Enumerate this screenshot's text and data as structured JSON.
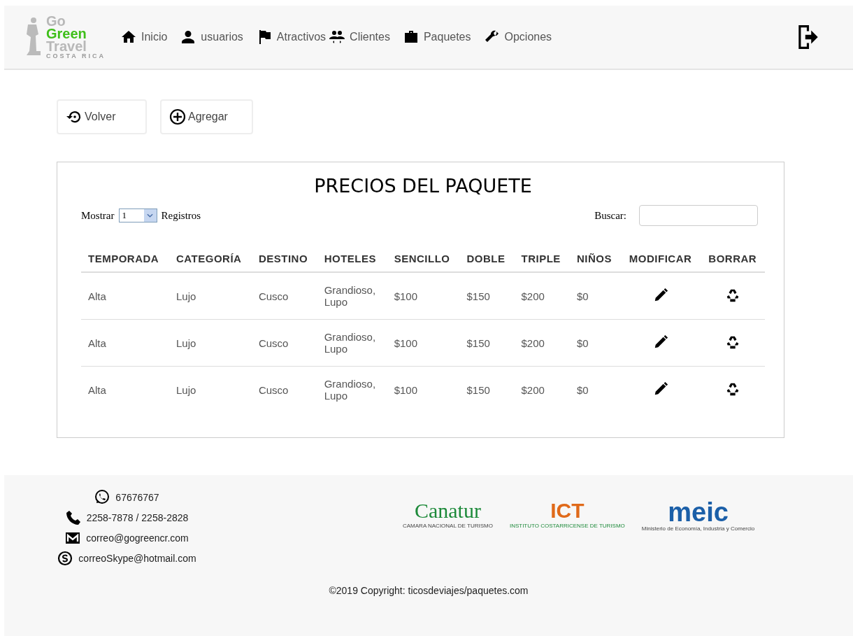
{
  "logo": {
    "line_1": "Go",
    "line_2": "Green",
    "line_3": "Travel",
    "line_4": "COSTA RICA"
  },
  "nav": [
    {
      "label": "Inicio"
    },
    {
      "label": "usuarios"
    },
    {
      "label": "Atractivos"
    },
    {
      "label": "Clientes"
    },
    {
      "label": "Paquetes"
    },
    {
      "label": "Opciones"
    }
  ],
  "actions": [
    {
      "label": "Volver"
    },
    {
      "label": "Agregar"
    }
  ],
  "panel": {
    "title": "PRECIOS DEL PAQUETE",
    "show_label": "Mostrar",
    "show_value": "1",
    "records_label": "Registros",
    "search_label": "Buscar:"
  },
  "table": {
    "columns": [
      "TEMPORADA",
      "CATEGORÍA",
      "DESTINO",
      "HOTELES",
      "SENCILLO",
      "DOBLE",
      "TRIPLE",
      "NIÑOS",
      "MODIFICAR",
      "BORRAR"
    ],
    "rows": [
      [
        "Alta",
        "Lujo",
        "Cusco",
        "Grandioso, Lupo",
        "$100",
        "$150",
        "$200",
        "$0"
      ],
      [
        "Alta",
        "Lujo",
        "Cusco",
        "Grandioso, Lupo",
        "$100",
        "$150",
        "$200",
        "$0"
      ],
      [
        "Alta",
        "Lujo",
        "Cusco",
        "Grandioso, Lupo",
        "$100",
        "$150",
        "$200",
        "$0"
      ]
    ]
  },
  "contacts": [
    "67676767",
    "2258-7878 / 2258-2828",
    "correo@gogreencr.com",
    "correoSkype@hotmail.com"
  ],
  "partners": [
    {
      "name": "Canatur",
      "subtitle": "CAMARA NACIONAL DE TURISMO"
    },
    {
      "name": "ICT",
      "subtitle": "INSTITUTO COSTARRICENSE DE TURISMO"
    },
    {
      "name": "meic",
      "subtitle": "Ministerio de Economía, Industria y Comercio"
    }
  ],
  "copyright": "©2019 Copyright: ticosdeviajes/paquetes.com"
}
